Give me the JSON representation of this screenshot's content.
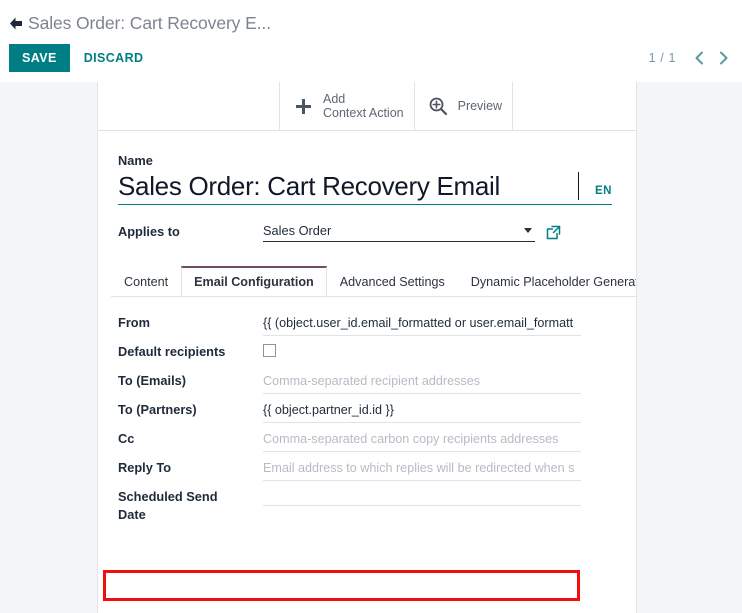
{
  "header": {
    "back_icon": "back-arrow-icon",
    "breadcrumb_title": "Sales Order: Cart Recovery E...",
    "save_label": "SAVE",
    "discard_label": "DISCARD",
    "pager_count": "1 / 1",
    "prev_icon": "chevron-left-icon",
    "next_icon": "chevron-right-icon"
  },
  "toolbar": {
    "buttons": [
      {
        "icon": "plus-icon",
        "label": "Add\nContext Action"
      },
      {
        "icon": "magnifier-plus-icon",
        "label": "Preview"
      }
    ]
  },
  "form": {
    "name_label": "Name",
    "name_value": "Sales Order: Cart Recovery Email",
    "lang_badge": "EN",
    "applies_to_label": "Applies to",
    "applies_to_value": "Sales Order",
    "external_link_icon": "external-link-icon",
    "dropdown_icon": "chevron-down-icon"
  },
  "tabs": [
    {
      "label": "Content",
      "active": false
    },
    {
      "label": "Email Configuration",
      "active": true
    },
    {
      "label": "Advanced Settings",
      "active": false
    },
    {
      "label": "Dynamic Placeholder Generator",
      "active": false
    }
  ],
  "fields": [
    {
      "label": "From",
      "type": "text",
      "value": "{{ (object.user_id.email_formatted or user.email_formatt",
      "placeholder": ""
    },
    {
      "label": "Default recipients",
      "type": "checkbox",
      "checked": false
    },
    {
      "label": "To (Emails)",
      "type": "text",
      "value": "",
      "placeholder": "Comma-separated recipient addresses"
    },
    {
      "label": "To (Partners)",
      "type": "text",
      "value": "{{ object.partner_id.id }}",
      "placeholder": ""
    },
    {
      "label": "Cc",
      "type": "text",
      "value": "",
      "placeholder": "Comma-separated carbon copy recipients addresses"
    },
    {
      "label": "Reply To",
      "type": "text",
      "value": "",
      "placeholder": "Email address to which replies will be redirected when s",
      "highlighted": true
    },
    {
      "label": "Scheduled Send\nDate",
      "type": "text",
      "value": "",
      "placeholder": ""
    }
  ],
  "colors": {
    "accent_teal": "#017e84",
    "tab_active_border": "#714b67",
    "highlight_red": "#f50d0d",
    "page_bg": "#f4f5f8"
  }
}
